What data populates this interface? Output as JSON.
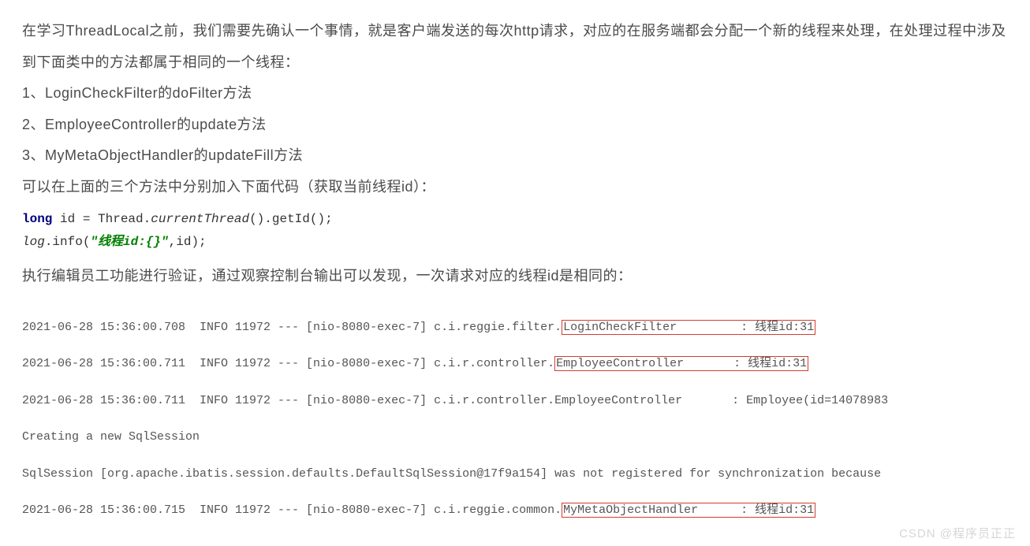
{
  "para1": "在学习ThreadLocal之前，我们需要先确认一个事情，就是客户端发送的每次http请求，对应的在服务端都会分配一个新的线程来处理，在处理过程中涉及到下面类中的方法都属于相同的一个线程：",
  "list": {
    "item1": "1、LoginCheckFilter的doFilter方法",
    "item2": "2、EmployeeController的update方法",
    "item3": "3、MyMetaObjectHandler的updateFill方法"
  },
  "para2": "可以在上面的三个方法中分别加入下面代码（获取当前线程id）：",
  "code": {
    "kw_long": "long",
    "l1_rest": " id = Thread.",
    "l1_method": "currentThread",
    "l1_end": "().getId();",
    "l2_var": "log",
    "l2_mid": ".info(",
    "l2_str": "\"线程id:{}\"",
    "l2_end": ",id);"
  },
  "para3": "执行编辑员工功能进行验证，通过观察控制台输出可以发现，一次请求对应的线程id是相同的：",
  "console": {
    "l1": {
      "pre": "2021-06-28 15:36:00.708  INFO 11972 --- [nio-8080-exec-7] c.i.reggie.filter.",
      "box": "LoginCheckFilter         : 线程id:31"
    },
    "l2": {
      "pre": "2021-06-28 15:36:00.711  INFO 11972 --- [nio-8080-exec-7] c.i.r.controller.",
      "box": "EmployeeController       : 线程id:31"
    },
    "l3": "2021-06-28 15:36:00.711  INFO 11972 --- [nio-8080-exec-7] c.i.r.controller.EmployeeController       : Employee(id=14078983",
    "l4": "Creating a new SqlSession",
    "l5": "SqlSession [org.apache.ibatis.session.defaults.DefaultSqlSession@17f9a154] was not registered for synchronization because",
    "l6": {
      "pre": "2021-06-28 15:36:00.715  INFO 11972 --- [nio-8080-exec-7] c.i.reggie.common.",
      "box": "MyMetaObjectHandler      : 线程id:31"
    }
  },
  "watermark": "CSDN @程序员正正"
}
